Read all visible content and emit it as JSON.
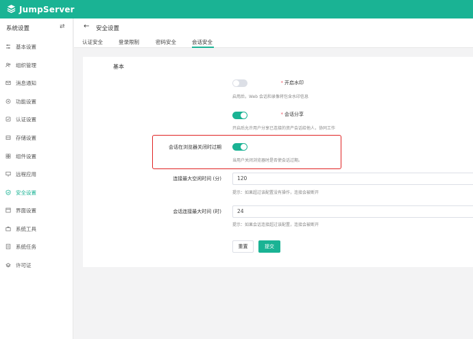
{
  "app": {
    "brand": "JumpServer"
  },
  "sidebar": {
    "title": "系统设置",
    "toggle_glyph": "⇄",
    "items": [
      {
        "label": "基本设置",
        "icon": "sliders-icon"
      },
      {
        "label": "组织管理",
        "icon": "users-icon"
      },
      {
        "label": "消息通知",
        "icon": "mail-icon"
      },
      {
        "label": "功能设置",
        "icon": "feature-icon"
      },
      {
        "label": "认证设置",
        "icon": "auth-icon"
      },
      {
        "label": "存储设置",
        "icon": "storage-icon"
      },
      {
        "label": "组件设置",
        "icon": "component-icon"
      },
      {
        "label": "远程应用",
        "icon": "remote-app-icon"
      },
      {
        "label": "安全设置",
        "icon": "shield-icon",
        "active": true
      },
      {
        "label": "界面设置",
        "icon": "interface-icon"
      },
      {
        "label": "系统工具",
        "icon": "toolbox-icon"
      },
      {
        "label": "系统任务",
        "icon": "task-icon"
      },
      {
        "label": "许可证",
        "icon": "license-icon"
      }
    ]
  },
  "header": {
    "back_glyph": "←",
    "title": "安全设置",
    "tabs": [
      {
        "label": "认证安全"
      },
      {
        "label": "登录限制"
      },
      {
        "label": "密码安全"
      },
      {
        "label": "会话安全",
        "active": true
      }
    ]
  },
  "form": {
    "section_title": "基本",
    "required_mark": "*",
    "watermark": {
      "label": "开启水印",
      "enabled": false,
      "help": "启用后，Web 会话和录像将包含水印信息"
    },
    "session_share": {
      "label": "会话分享",
      "enabled": true,
      "help": "开启后允许用户分享已连接的资产会话给他人，协同工作"
    },
    "expire_on_browser_close": {
      "label": "会话在浏览器关闭时过期",
      "enabled": true,
      "help": "当用户关闭浏览器时是否使会话过期。"
    },
    "max_idle_time": {
      "label": "连接最大空闲时间 (分)",
      "value": "120",
      "help": "提示：如果超过该配置没有操作，连接会被断开"
    },
    "max_session_time": {
      "label": "会话连接最大时间 (时)",
      "value": "24",
      "help": "提示：如果会话连接超过该配置，连接会被断开"
    },
    "reset_label": "重置",
    "submit_label": "提交"
  },
  "colors": {
    "brand": "#1ab394",
    "highlight": "#e02020",
    "required": "#ed5565"
  }
}
